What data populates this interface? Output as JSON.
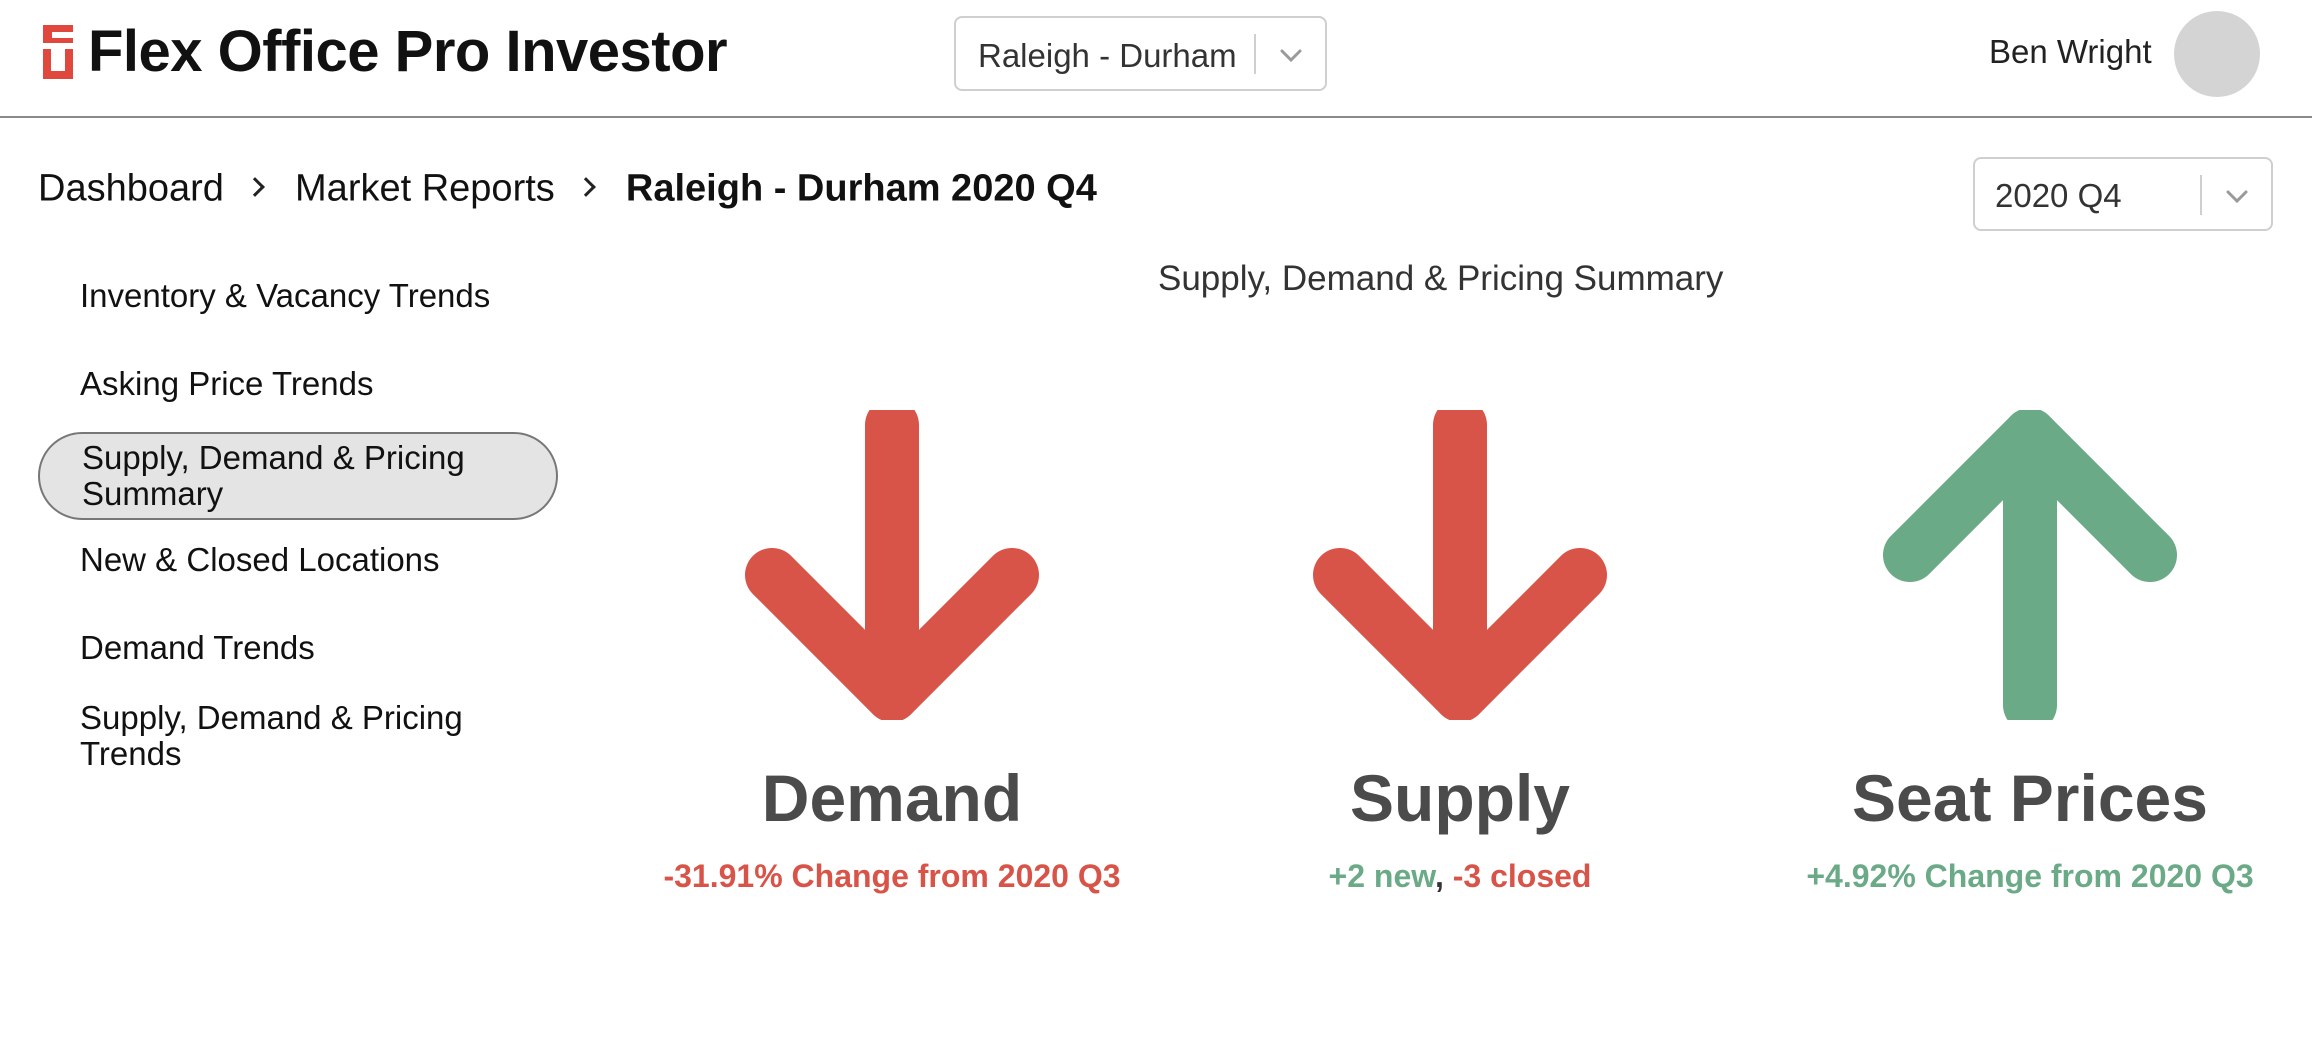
{
  "app": {
    "title": "Flex Office Pro Investor",
    "brand_color": "#e0483d"
  },
  "header": {
    "market_select": {
      "value": "Raleigh - Durham"
    },
    "user": {
      "name": "Ben Wright"
    }
  },
  "breadcrumb": [
    {
      "label": "Dashboard"
    },
    {
      "label": "Market Reports"
    },
    {
      "label": "Raleigh - Durham 2020 Q4"
    }
  ],
  "period_select": {
    "value": "2020 Q4"
  },
  "sidebar": {
    "items": [
      {
        "label": "Inventory & Vacancy Trends",
        "active": false
      },
      {
        "label": "Asking Price Trends",
        "active": false
      },
      {
        "label": "Supply, Demand & Pricing Summary",
        "active": true
      },
      {
        "label": "New & Closed Locations",
        "active": false
      },
      {
        "label": "Demand Trends",
        "active": false
      },
      {
        "label": "Supply, Demand & Pricing Trends",
        "active": false
      }
    ]
  },
  "main": {
    "section_title": "Supply, Demand & Pricing Summary",
    "metrics": [
      {
        "label": "Demand",
        "direction": "down",
        "color": "#d85448",
        "sub": "-31.91% Change from 2020 Q3"
      },
      {
        "label": "Supply",
        "direction": "down",
        "color": "#d85448",
        "sub_new": "+2 new",
        "sub_sep": ",",
        "sub_closed": " -3 closed"
      },
      {
        "label": "Seat Prices",
        "direction": "up",
        "color": "#6aaa86",
        "sub": "+4.92% Change from 2020 Q3"
      }
    ]
  }
}
